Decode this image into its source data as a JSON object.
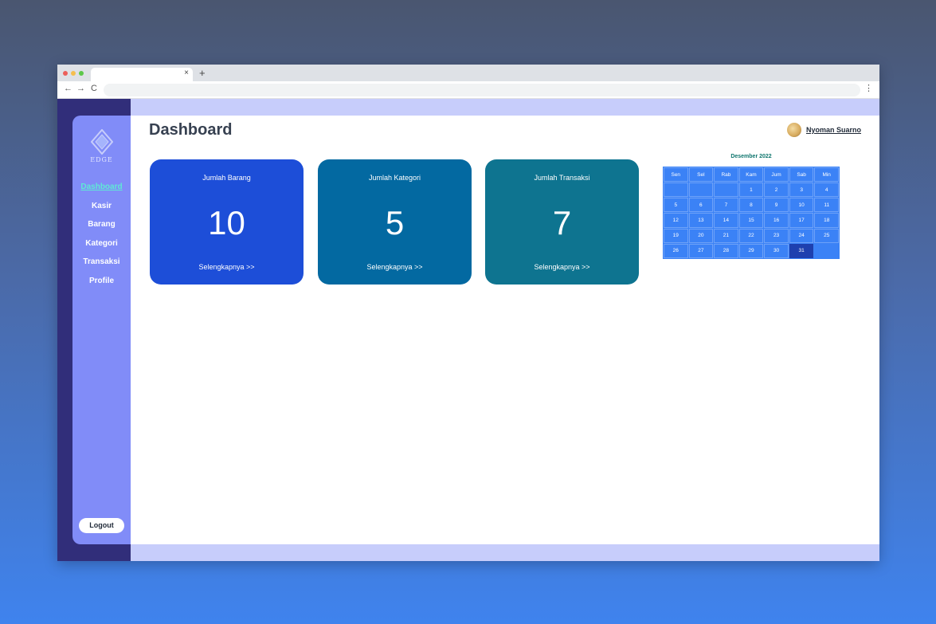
{
  "browser": {
    "tab_close": "×",
    "new_tab": "+",
    "back": "←",
    "forward": "→",
    "reload": "C",
    "menu": "⋮"
  },
  "brand": {
    "logo_text": "EDGE"
  },
  "sidebar": {
    "items": [
      {
        "label": "Dashboard",
        "active": true
      },
      {
        "label": "Kasir"
      },
      {
        "label": "Barang"
      },
      {
        "label": "Kategori"
      },
      {
        "label": "Transaksi"
      },
      {
        "label": "Profile"
      }
    ],
    "logout_label": "Logout"
  },
  "header": {
    "title": "Dashboard",
    "user_name": "Nyoman Suarno"
  },
  "cards": [
    {
      "label": "Jumlah Barang",
      "value": "10",
      "link": "Selengkapnya >>",
      "color": "#1d4ed8"
    },
    {
      "label": "Jumlah Kategori",
      "value": "5",
      "link": "Selengkapnya >>",
      "color": "#0369a1"
    },
    {
      "label": "Jumlah Transaksi",
      "value": "7",
      "link": "Selengkapnya >>",
      "color": "#0e7490"
    }
  ],
  "calendar": {
    "title": "Desember 2022",
    "weekdays": [
      "Sen",
      "Sel",
      "Rab",
      "Kam",
      "Jum",
      "Sab",
      "Min"
    ],
    "days": [
      "",
      "",
      "",
      "1",
      "2",
      "3",
      "4",
      "5",
      "6",
      "7",
      "8",
      "9",
      "10",
      "11",
      "12",
      "13",
      "14",
      "15",
      "16",
      "17",
      "18",
      "19",
      "20",
      "21",
      "22",
      "23",
      "24",
      "25",
      "26",
      "27",
      "28",
      "29",
      "30",
      "31",
      ""
    ],
    "today": "31"
  },
  "colors": {
    "sidebar": "#818cf8",
    "sidebar_dark": "#312e7a",
    "strip": "#c7cdfb",
    "calendar": "#3b82f6",
    "active_nav": "#5eead4"
  }
}
